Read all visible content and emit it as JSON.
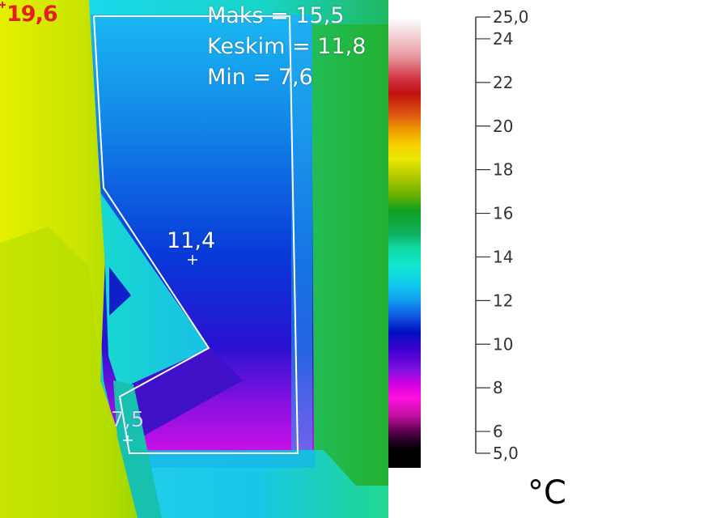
{
  "measurements": {
    "max_line": "Maks = 15,5",
    "avg_line": "Keskim = 11,8",
    "min_line": "Min = 7,6"
  },
  "spots": {
    "hot_label": "19,6",
    "center_label": "11,4",
    "cold_label": "7,5"
  },
  "scale": {
    "top_label": "25,0",
    "bottom_label": "5,0",
    "ticks": [
      "24",
      "22",
      "20",
      "18",
      "16",
      "14",
      "12",
      "10",
      "8",
      "6"
    ],
    "unit": "°C"
  },
  "palette_colors": {
    "hot": "#e0201a",
    "overlay_text": "#ffffff",
    "roi_outline": "#ffffff"
  }
}
